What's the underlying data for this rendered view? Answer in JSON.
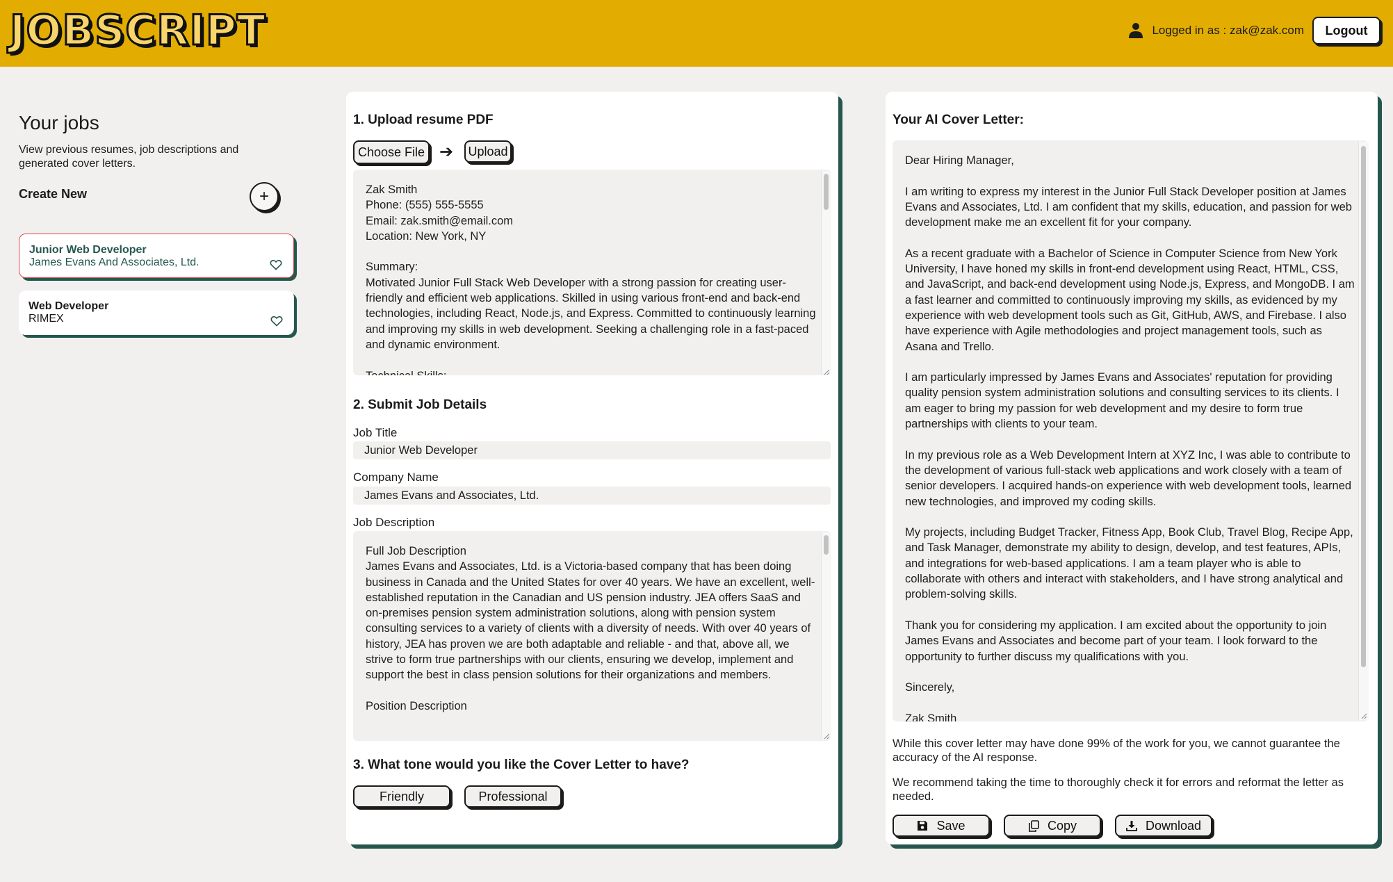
{
  "app": {
    "logo": "JOBSCRIPT"
  },
  "header": {
    "user_label": "Logged in as : zak@zak.com",
    "logout_label": "Logout"
  },
  "sidebar": {
    "title": "Your jobs",
    "description": "View previous resumes, job descriptions and generated cover letters.",
    "create_label": "Create New",
    "add_symbol": "+",
    "jobs": [
      {
        "title": "Junior Web Developer",
        "company": "James Evans And Associates, Ltd."
      },
      {
        "title": "Web Developer",
        "company": "RIMEX"
      }
    ]
  },
  "upload": {
    "heading": "1. Upload resume PDF",
    "choose_label": "Choose File",
    "upload_label": "Upload",
    "resume_text": "Zak Smith\nPhone: (555) 555-5555\nEmail: zak.smith@email.com\nLocation: New York, NY\n\nSummary:\nMotivated Junior Full Stack Web Developer with a strong passion for creating user-friendly and efficient web applications. Skilled in using various front-end and back-end technologies, including React, Node.js, and Express. Committed to continuously learning and improving my skills in web development. Seeking a challenging role in a fast-paced and dynamic environment.\n\nTechnical Skills:"
  },
  "job_details": {
    "heading": "2. Submit Job Details",
    "job_title_label": "Job Title",
    "job_title_value": "Junior Web Developer",
    "company_label": "Company Name",
    "company_value": "James Evans and Associates, Ltd.",
    "description_label": "Job Description",
    "description_text": "Full Job Description\nJames Evans and Associates, Ltd. is a Victoria-based company that has been doing business in Canada and the United States for over 40 years. We have an excellent, well-established reputation in the Canadian and US pension industry. JEA offers SaaS and on-premises pension system administration solutions, along with pension system consulting services to a variety of clients with a diversity of needs. With over 40 years of history, JEA has proven we are both adaptable and reliable - and that, above all, we strive to form true partnerships with our clients, ensuring we develop, implement and support the best in class pension solutions for their organizations and members.\n\nPosition Description"
  },
  "tone": {
    "heading": "3. What tone would you like the Cover Letter to have?",
    "friendly_label": "Friendly",
    "professional_label": "Professional"
  },
  "cover_letter": {
    "heading": "Your AI Cover Letter:",
    "text": "Dear Hiring Manager,\n\nI am writing to express my interest in the Junior Full Stack Developer position at James Evans and Associates, Ltd. I am confident that my skills, education, and passion for web development make me an excellent fit for your company.\n\nAs a recent graduate with a Bachelor of Science in Computer Science from New York University, I have honed my skills in front-end development using React, HTML, CSS, and JavaScript, and back-end development using Node.js, Express, and MongoDB. I am a fast learner and committed to continuously improving my skills, as evidenced by my experience with web development tools such as Git, GitHub, AWS, and Firebase. I also have experience with Agile methodologies and project management tools, such as Asana and Trello.\n\nI am particularly impressed by James Evans and Associates' reputation for providing quality pension system administration solutions and consulting services to its clients. I am eager to bring my passion for web development and my desire to form true partnerships with clients to your team.\n\nIn my previous role as a Web Development Intern at XYZ Inc, I was able to contribute to the development of various full-stack web applications and work closely with a team of senior developers. I acquired hands-on experience with web development tools, learned new technologies, and improved my coding skills.\n\nMy projects, including Budget Tracker, Fitness App, Book Club, Travel Blog, Recipe App, and Task Manager, demonstrate my ability to design, develop, and test features, APIs, and integrations for web-based applications. I am a team player who is able to collaborate with others and interact with stakeholders, and I have strong analytical and problem-solving skills.\n\nThank you for considering my application. I am excited about the opportunity to join James Evans and Associates and become part of your team. I look forward to the opportunity to further discuss my qualifications with you.\n\nSincerely,\n\nZak Smith",
    "disclaimer_1": "While this cover letter may have done 99% of the work for you, we cannot guarantee the accuracy of the AI response.",
    "disclaimer_2": "We recommend taking the time to thoroughly check it for errors and reformat the letter as needed.",
    "save_label": "Save",
    "copy_label": "Copy",
    "download_label": "Download"
  },
  "icons": {
    "user": "user-icon",
    "heart": "heart-icon",
    "arrow": "arrow-right-icon",
    "save": "floppy-disk-icon",
    "copy": "copy-icon",
    "download": "download-icon"
  },
  "colors": {
    "header": "#e2ad00",
    "accent": "#24564e",
    "active_border": "#d9474a"
  }
}
